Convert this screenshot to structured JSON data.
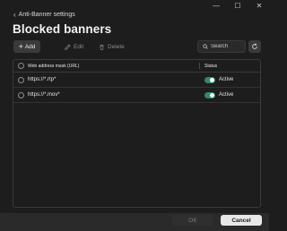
{
  "window": {
    "controls": {
      "minimize": "—",
      "maximize": "☐",
      "close": "✕"
    }
  },
  "nav": {
    "back_label": "Anti-Banner settings"
  },
  "page": {
    "title": "Blocked banners"
  },
  "toolbar": {
    "add_label": "Add",
    "edit_label": "Edit",
    "delete_label": "Delete",
    "search_placeholder": "Search"
  },
  "table": {
    "headers": {
      "mask": "Web address mask (URL)",
      "status": "Status"
    },
    "rows": [
      {
        "mask": "https://*.rtp*",
        "status": "Active",
        "enabled": true
      },
      {
        "mask": "https://*.mov*",
        "status": "Active",
        "enabled": true
      }
    ]
  },
  "footer": {
    "ok_label": "OK",
    "cancel_label": "Cancel"
  },
  "colors": {
    "background": "#1d1d1d",
    "toggle_on": "#2f8a6a",
    "cancel_bg": "#e8e8e8"
  }
}
